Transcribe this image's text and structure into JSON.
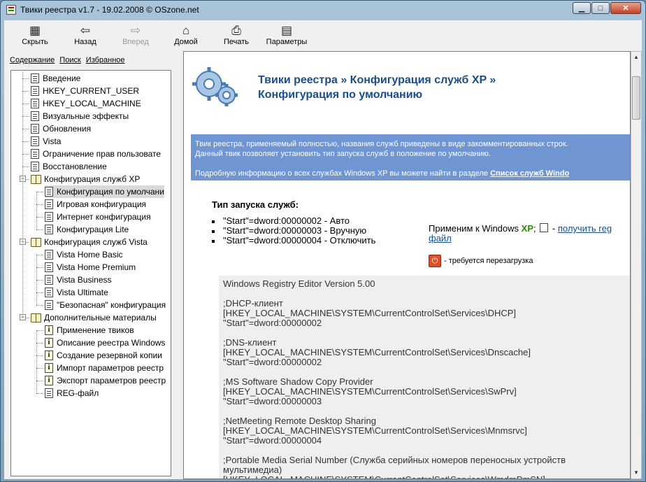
{
  "window": {
    "title": "Твики реестра v1.7 - 19.02.2008 © OSzone.net"
  },
  "toolbar": {
    "buttons": [
      {
        "label": "Скрыть",
        "icon": "hide-icon"
      },
      {
        "label": "Назад",
        "icon": "back-arrow-icon"
      },
      {
        "label": "Вперед",
        "icon": "forward-arrow-icon"
      },
      {
        "label": "Домой",
        "icon": "home-icon"
      },
      {
        "label": "Печать",
        "icon": "print-icon"
      },
      {
        "label": "Параметры",
        "icon": "options-icon"
      }
    ]
  },
  "tabs": [
    "Содержание",
    "Поиск",
    "Избранное"
  ],
  "tree": {
    "items": [
      "Введение",
      "HKEY_CURRENT_USER",
      "HKEY_LOCAL_MACHINE",
      "Визуальные эффекты",
      "Обновления",
      "Vista",
      "Ограничение прав пользовате",
      "Восстановление",
      "Конфигурация служб XP",
      "Конфигурация по умолчани",
      "Игровая конфигурация",
      "Интернет конфигурация",
      "Конфигурация Lite",
      "Конфигурация служб Vista",
      "Vista Home Basic",
      "Vista Home Premium",
      "Vista Business",
      "Vista Ultimate",
      "\"Безопасная\" конфигурация",
      "Дополнительные материалы",
      "Применение твиков",
      "Описание реестра Windows",
      "Создание резервной копии",
      "Импорт параметров реестр",
      "Экспорт параметров реестр",
      "REG-файл"
    ]
  },
  "content": {
    "title_line1": "Твики реестра » Конфигурация служб XP »",
    "title_line2": "Конфигурация по умолчанию",
    "desc1": "Твик реестра, применяемый полностью, названия служб приведены в виде закомментированных строк.",
    "desc2": "Данный твик позволяет установить тип запуска служб в положение по умолчанию.",
    "desc3": "Подробную информацию о всех службах Windows XP вы можете найти в разделе",
    "desc3_link": "Список служб Windo",
    "start_heading": "Тип запуска служб:",
    "start_items": [
      "\"Start\"=dword:00000002 - Авто",
      "\"Start\"=dword:00000003 - Вручную",
      "\"Start\"=dword:00000004 - Отключить"
    ],
    "apply_prefix": "Применим к Windows",
    "apply_xp": "XP",
    "apply_sep": ";",
    "apply_dash": "-",
    "apply_link1": "получить reg",
    "apply_link2": "файл",
    "restart_text": "- требуется перезагрузка",
    "code": "Windows Registry Editor Version 5.00\n\n;DHCP-клиент\n[HKEY_LOCAL_MACHINE\\SYSTEM\\CurrentControlSet\\Services\\DHCP]\n\"Start\"=dword:00000002\n\n;DNS-клиент\n[HKEY_LOCAL_MACHINE\\SYSTEM\\CurrentControlSet\\Services\\Dnscache]\n\"Start\"=dword:00000002\n\n;MS Software Shadow Copy Provider\n[HKEY_LOCAL_MACHINE\\SYSTEM\\CurrentControlSet\\Services\\SwPrv]\n\"Start\"=dword:00000003\n\n;NetMeeting Remote Desktop Sharing\n[HKEY_LOCAL_MACHINE\\SYSTEM\\CurrentControlSet\\Services\\Mnmsrvc]\n\"Start\"=dword:00000004\n\n;Portable Media Serial Number (Служба серийных номеров переносных устройств\nмультимедиа)\n[HKEY_LOCAL_MACHINE\\SYSTEM\\CurrentControlSet\\Services\\WmdmPmSN]"
  },
  "colors": {
    "accent_blue": "#6f96d2",
    "title_blue": "#1a4e8a",
    "xp_green": "#2e8b00"
  }
}
